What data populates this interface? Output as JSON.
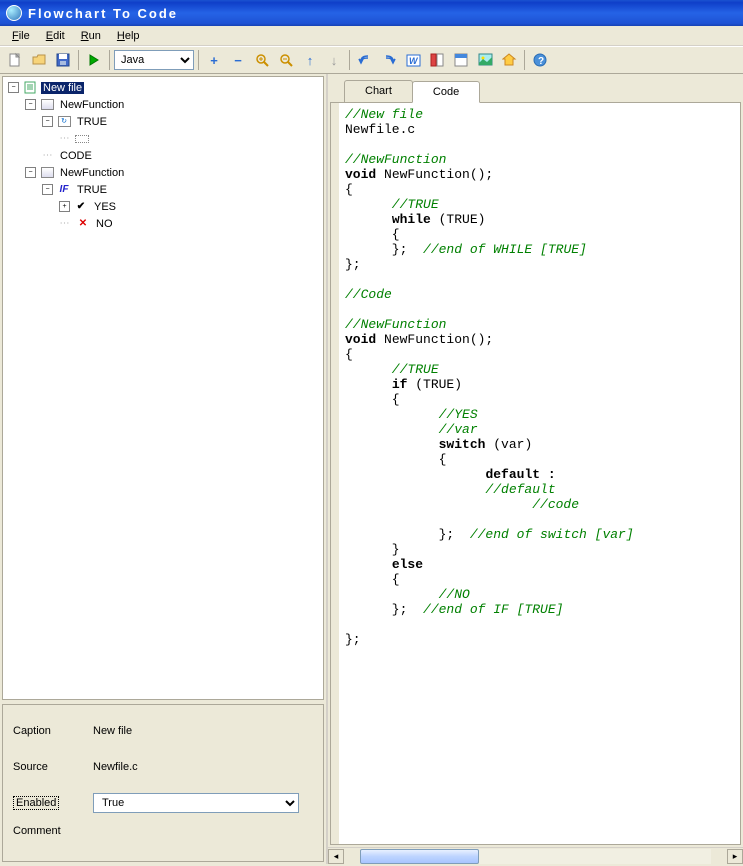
{
  "title": "Flowchart To Code",
  "menu": {
    "file": "File",
    "edit": "Edit",
    "run": "Run",
    "help": "Help"
  },
  "toolbar": {
    "new": "new-file",
    "open": "open-file",
    "save": "save",
    "run": "run",
    "lang": "Java",
    "add": "+",
    "remove": "−",
    "zoomin": "zoom-in",
    "zoomout": "zoom-out",
    "up": "up",
    "down": "down",
    "undo": "undo",
    "redo": "redo",
    "word": "word",
    "layout1": "layout1",
    "layout2": "layout2",
    "image": "image",
    "home": "home",
    "help": "help"
  },
  "tree": {
    "root": "New file",
    "fn1": {
      "name": "NewFunction",
      "loop": "TRUE",
      "code": "CODE"
    },
    "fn2": {
      "name": "NewFunction",
      "cond": "TRUE",
      "yes": "YES",
      "no": "NO"
    }
  },
  "props": {
    "caption_label": "Caption",
    "caption": "New file",
    "source_label": "Source",
    "source": "Newfile.c",
    "enabled_label": "Enabled",
    "enabled": "True",
    "comment_label": "Comment"
  },
  "tabs": {
    "chart": "Chart",
    "code": "Code"
  },
  "code": [
    {
      "t": "c",
      "s": "//New file"
    },
    {
      "t": "",
      "s": "Newfile.c"
    },
    {
      "t": "",
      "s": ""
    },
    {
      "t": "c",
      "s": "//NewFunction"
    },
    {
      "t": "kv",
      "k": "void",
      "s": " NewFunction();"
    },
    {
      "t": "",
      "s": "{"
    },
    {
      "t": "c",
      "s": "      //TRUE"
    },
    {
      "t": "ki",
      "i": "      ",
      "k": "while",
      "s": " (TRUE)"
    },
    {
      "t": "",
      "s": "      {"
    },
    {
      "t": "mix",
      "pre": "      };  ",
      "c": "//end of WHILE [TRUE]"
    },
    {
      "t": "",
      "s": "};"
    },
    {
      "t": "",
      "s": ""
    },
    {
      "t": "c",
      "s": "//Code"
    },
    {
      "t": "",
      "s": ""
    },
    {
      "t": "c",
      "s": "//NewFunction"
    },
    {
      "t": "kv",
      "k": "void",
      "s": " NewFunction();"
    },
    {
      "t": "",
      "s": "{"
    },
    {
      "t": "c",
      "s": "      //TRUE"
    },
    {
      "t": "ki",
      "i": "      ",
      "k": "if",
      "s": " (TRUE)"
    },
    {
      "t": "",
      "s": "      {"
    },
    {
      "t": "c",
      "s": "            //YES"
    },
    {
      "t": "c",
      "s": "            //var"
    },
    {
      "t": "ki",
      "i": "            ",
      "k": "switch",
      "s": " (var)"
    },
    {
      "t": "",
      "s": "            {"
    },
    {
      "t": "ki",
      "i": "                  ",
      "k": "default :",
      "s": ""
    },
    {
      "t": "c",
      "s": "                  //default"
    },
    {
      "t": "c",
      "s": "                        //code"
    },
    {
      "t": "",
      "s": ""
    },
    {
      "t": "mix",
      "pre": "            };  ",
      "c": "//end of switch [var]"
    },
    {
      "t": "",
      "s": "      }"
    },
    {
      "t": "ki",
      "i": "      ",
      "k": "else",
      "s": ""
    },
    {
      "t": "",
      "s": "      {"
    },
    {
      "t": "c",
      "s": "            //NO"
    },
    {
      "t": "mix",
      "pre": "      };  ",
      "c": "//end of IF [TRUE]"
    },
    {
      "t": "",
      "s": ""
    },
    {
      "t": "",
      "s": "};"
    }
  ]
}
